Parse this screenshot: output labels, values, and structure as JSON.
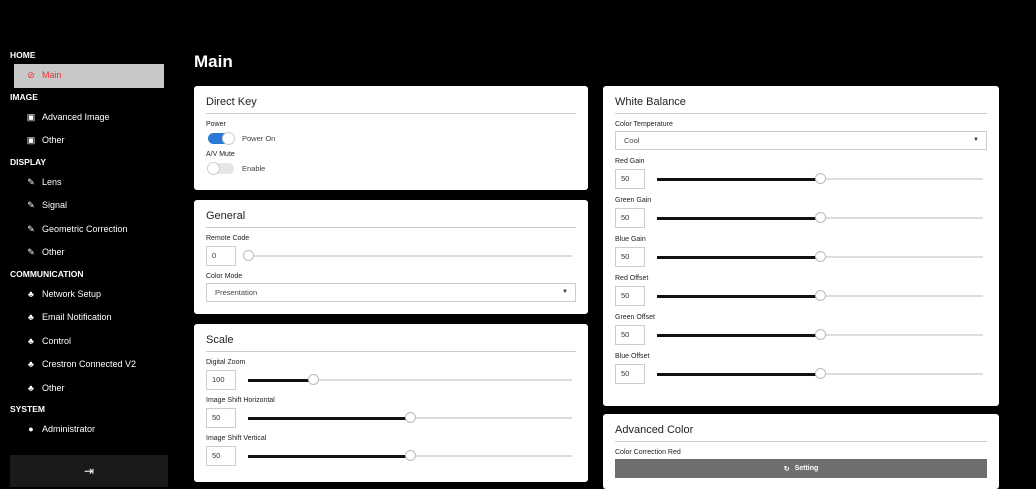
{
  "page_title": "Main",
  "sidebar": {
    "home": "HOME",
    "main": "Main",
    "image": "IMAGE",
    "advanced_image": "Advanced Image",
    "image_other": "Other",
    "display": "DISPLAY",
    "lens": "Lens",
    "signal": "Signal",
    "geometric": "Geometric Correction",
    "display_other": "Other",
    "communication": "COMMUNICATION",
    "network": "Network Setup",
    "email": "Email Notification",
    "control": "Control",
    "crestron": "Crestron Connected V2",
    "comm_other": "Other",
    "system": "SYSTEM",
    "admin": "Administrator"
  },
  "direct_key": {
    "title": "Direct Key",
    "power_label": "Power",
    "power_value": "Power On",
    "power_on": true,
    "mute_label": "A/V Mute",
    "mute_value": "Enable",
    "mute_on": false
  },
  "general": {
    "title": "General",
    "remote_label": "Remote Code",
    "remote_value": "0",
    "color_mode_label": "Color Mode",
    "color_mode_value": "Presentation"
  },
  "scale": {
    "title": "Scale",
    "zoom_label": "Digital Zoom",
    "zoom_value": "100",
    "hshift_label": "Image Shift Horizontal",
    "hshift_value": "50",
    "vshift_label": "Image Shift Vertical",
    "vshift_value": "50"
  },
  "white_balance": {
    "title": "White Balance",
    "temp_label": "Color Temperature",
    "temp_value": "Cool",
    "red_gain_label": "Red Gain",
    "red_gain": "50",
    "green_gain_label": "Green Gain",
    "green_gain": "50",
    "blue_gain_label": "Blue Gain",
    "blue_gain": "50",
    "red_offset_label": "Red Offset",
    "red_offset": "50",
    "green_offset_label": "Green Offset",
    "green_offset": "50",
    "blue_offset_label": "Blue Offset",
    "blue_offset": "50"
  },
  "advanced_color": {
    "title": "Advanced Color",
    "ccr_label": "Color Correction Red",
    "setting_label": "Setting"
  },
  "colors": {
    "accent": "#2979d6",
    "active_text": "#e33333",
    "button": "#6e6e6e"
  }
}
